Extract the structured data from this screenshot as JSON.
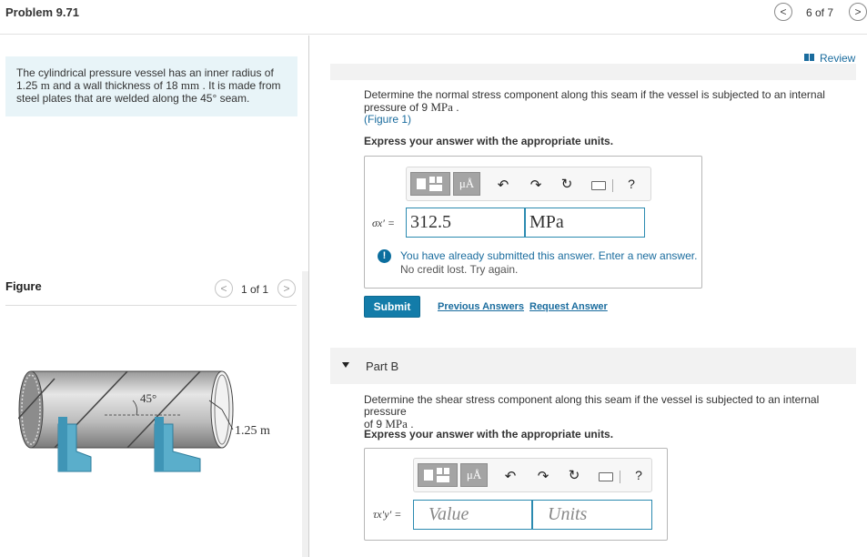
{
  "header": {
    "title": "Problem 9.71",
    "pager": "6 of 7",
    "prev_glyph": "<",
    "next_glyph": ">"
  },
  "problem": {
    "text_1": "The cylindrical pressure vessel has an inner radius of",
    "text_2a": "1.25 ",
    "unit_m": "m",
    "text_2b": " and a wall thickness of 18 ",
    "unit_mm": "mm",
    "text_2c": " . It is made from",
    "text_3": "steel plates that are welded along the 45° seam."
  },
  "figure": {
    "label": "Figure",
    "pager": "1 of 1",
    "angle_label": "45°",
    "radius_label": "1.25 m"
  },
  "review": {
    "label": "Review"
  },
  "part_a": {
    "question_1": "Determine the normal stress component along this seam if the vessel is subjected to an internal",
    "question_2a": "pressure of 9 ",
    "unit_mpa": "MPa",
    "question_2b": " .",
    "figure_link": "(Figure 1)",
    "express": "Express your answer with the appropriate units.",
    "toolbar_mu": "μÅ",
    "help": "?",
    "var_symbol": "σx′ =",
    "value": "312.5",
    "units": "MPa",
    "warning_1": "You have already submitted this answer. Enter a new answer.",
    "warning_2": "No credit lost. Try again.",
    "submit": "Submit",
    "previous_answers": "Previous Answers",
    "request_answer": "Request Answer"
  },
  "part_b": {
    "title": "Part B",
    "question_1": "Determine the shear stress component along this seam if the vessel is subjected to an internal pressure",
    "question_2a": "of 9 ",
    "unit_mpa": "MPa",
    "question_2b": " .",
    "express": "Express your answer with the appropriate units.",
    "toolbar_mu": "μÅ",
    "help": "?",
    "var_symbol": "τx′y′ =",
    "value_placeholder": "Value",
    "units_placeholder": "Units"
  },
  "colors": {
    "link": "#1a6c9e",
    "submit": "#137ca9",
    "problem_bg": "#e8f4f8",
    "support": "#5aaecb"
  }
}
